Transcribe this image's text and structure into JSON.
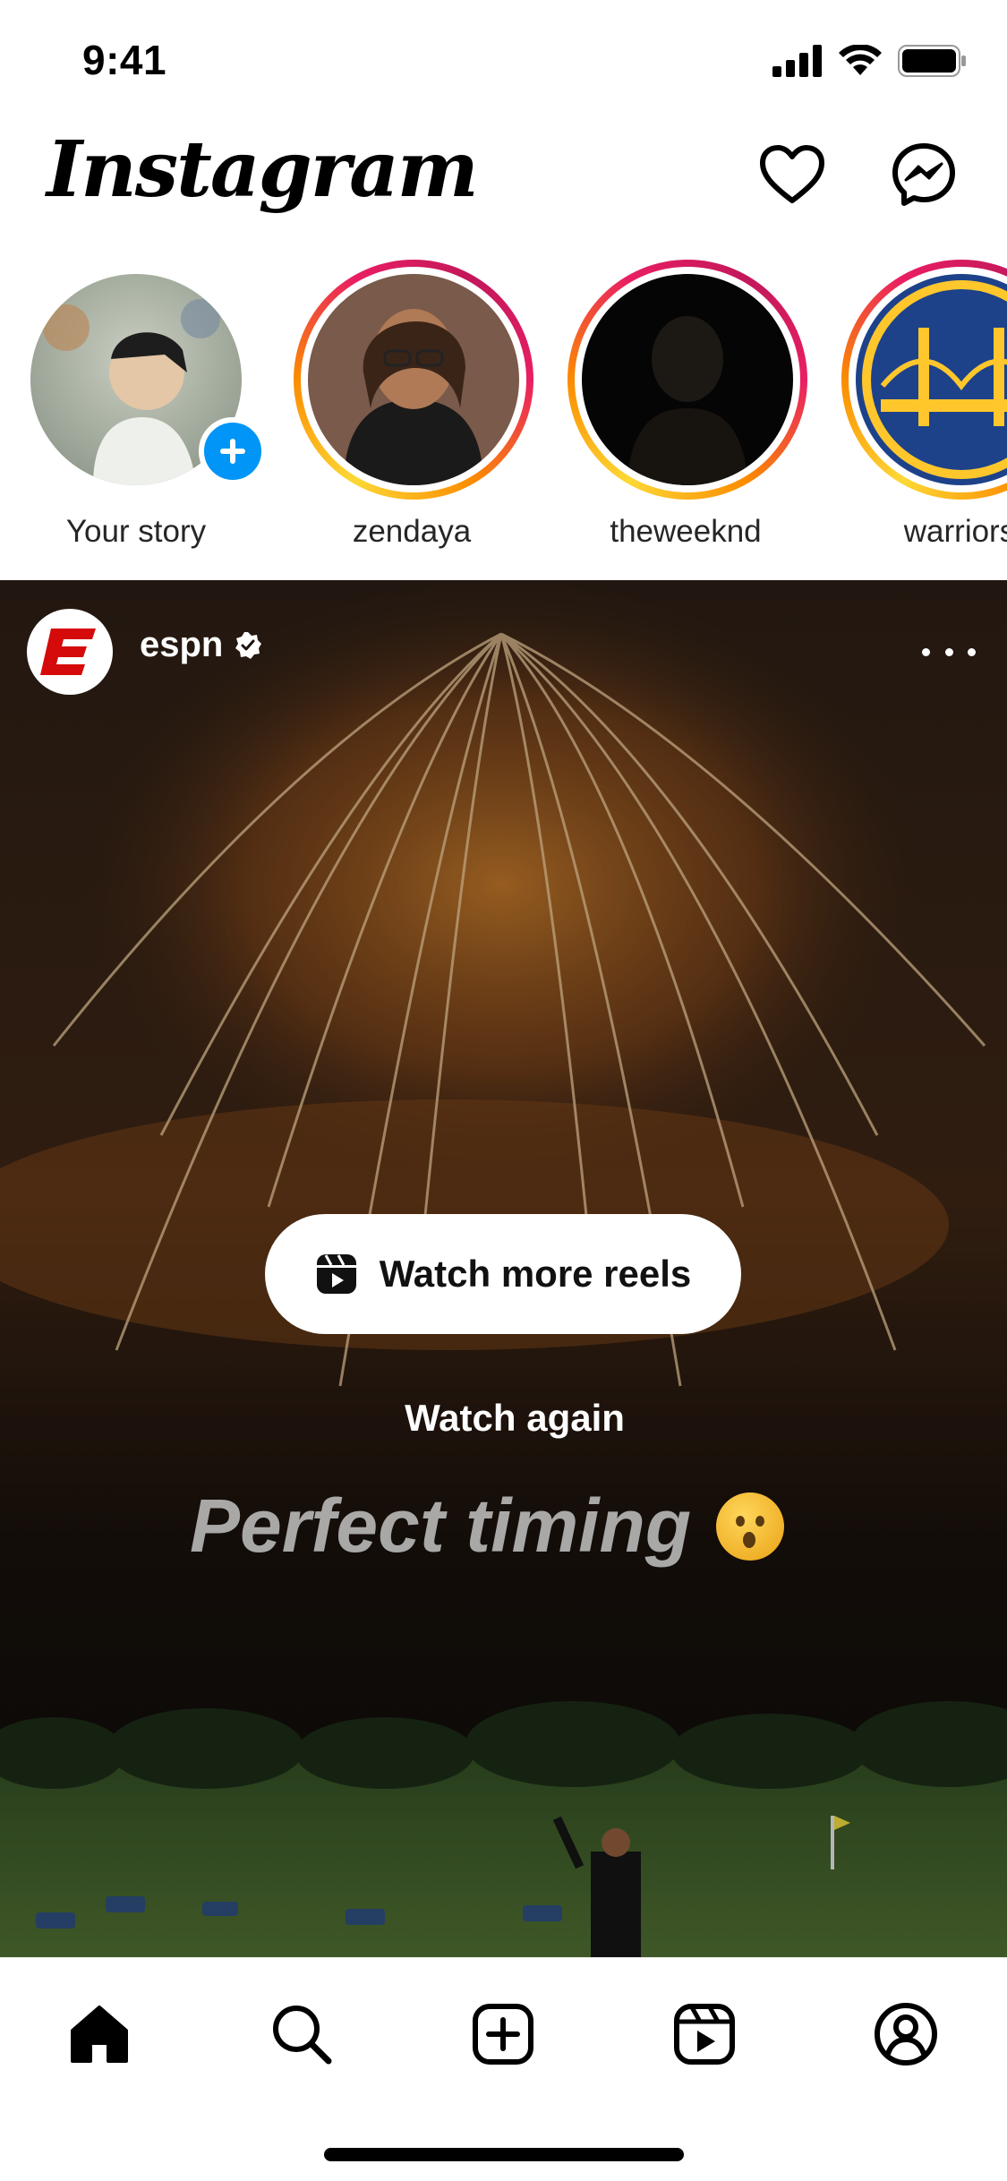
{
  "status_bar": {
    "time": "9:41"
  },
  "header": {
    "logo": "Instagram",
    "icons": [
      "heart-icon",
      "messenger-icon"
    ]
  },
  "stories": [
    {
      "label": "Your story",
      "own": true
    },
    {
      "label": "zendaya",
      "own": false
    },
    {
      "label": "theweeknd",
      "own": false
    },
    {
      "label": "warriors",
      "own": false
    }
  ],
  "post": {
    "username": "espn",
    "verified": true,
    "watch_more_label": "Watch more reels",
    "watch_again_label": "Watch again",
    "caption_overlay": "Perfect timing"
  },
  "tab_bar": {
    "items": [
      "home-icon",
      "search-icon",
      "create-icon",
      "reels-icon",
      "profile-icon"
    ],
    "active": "home-icon"
  },
  "colors": {
    "accent_blue": "#0095f6",
    "story_ring_start": "#fdd835",
    "story_ring_end": "#e91e63",
    "espn_red": "#d50a0a"
  }
}
